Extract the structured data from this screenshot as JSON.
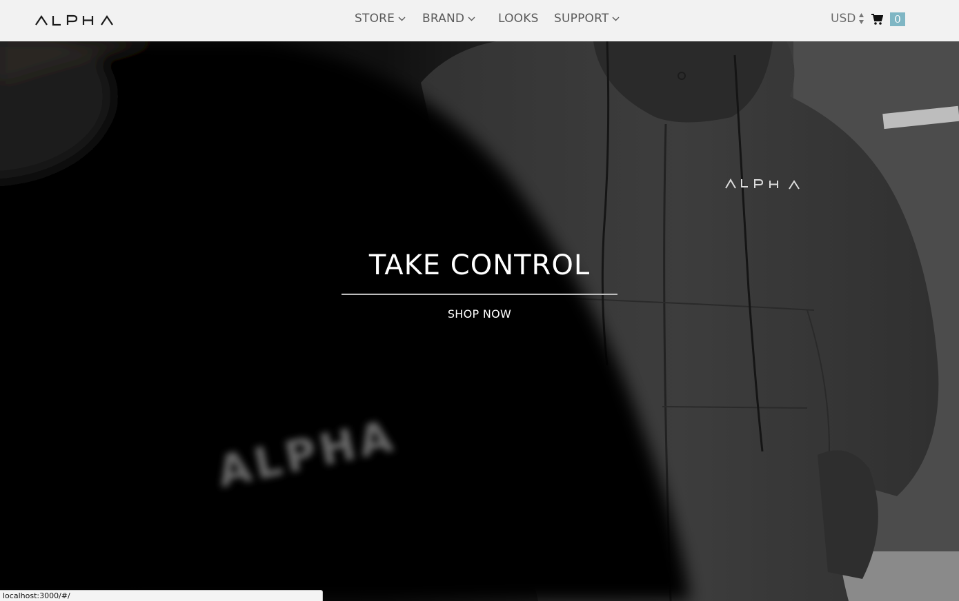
{
  "brand": {
    "logo_text": "ALPHA"
  },
  "nav": {
    "items": [
      {
        "label": "STORE",
        "has_dropdown": true
      },
      {
        "label": "BRAND",
        "has_dropdown": true
      },
      {
        "label": "LOOKS",
        "has_dropdown": false
      },
      {
        "label": "SUPPORT",
        "has_dropdown": true
      }
    ]
  },
  "header_right": {
    "currency": "USD",
    "cart_icon": "shopping-cart-icon",
    "cart_count": "0"
  },
  "hero": {
    "headline": "TAKE CONTROL",
    "cta_label": "SHOP NOW",
    "chest_logo_text": "ALPHA",
    "blurred_logo_text": "ALPHA"
  },
  "status_bar": {
    "url": "localhost:3000/#/"
  },
  "colors": {
    "header_bg": "#ffffff",
    "nav_text": "#5a5a5a",
    "cart_badge": "#7fb6c4",
    "hero_text": "#ffffff"
  }
}
